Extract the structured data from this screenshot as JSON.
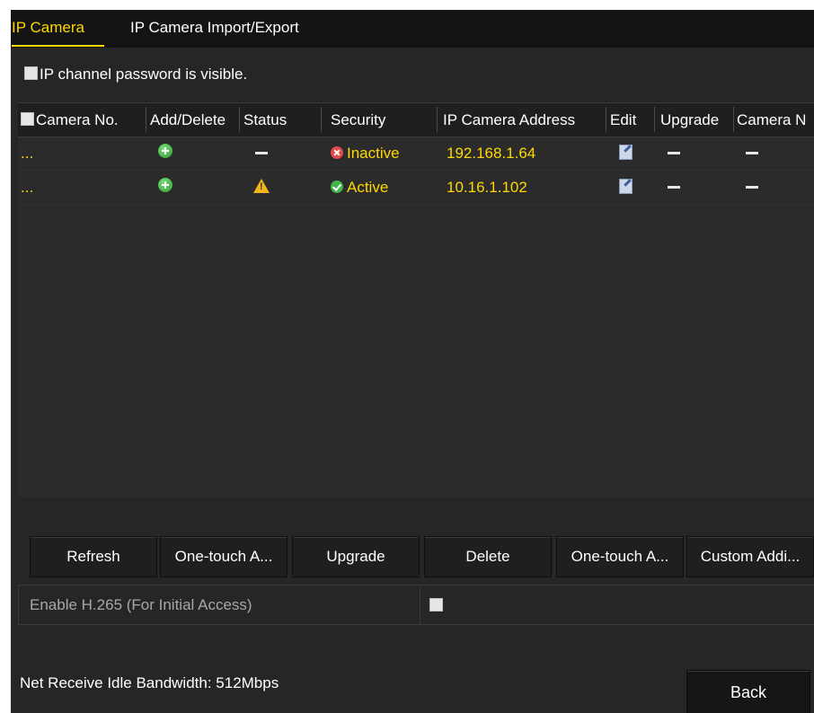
{
  "tabs": [
    {
      "label": "IP Camera",
      "active": true
    },
    {
      "label": "IP Camera Import/Export",
      "active": false
    }
  ],
  "password_visible": {
    "label": "IP channel password is visible.",
    "checked": false
  },
  "table": {
    "columns": [
      "Camera No.",
      "Add/Delete",
      "Status",
      "Security",
      "IP Camera Address",
      "Edit",
      "Upgrade",
      "Camera N"
    ],
    "rows": [
      {
        "camera_no": "...",
        "add_icon": "add-icon",
        "status": "dash",
        "security": "Inactive",
        "security_icon": "error-icon",
        "ip": "192.168.1.64",
        "edit_icon": "edit-icon",
        "upgrade": "dash",
        "camera_name": "dash"
      },
      {
        "camera_no": "...",
        "add_icon": "add-icon",
        "status": "warning",
        "security": "Active",
        "security_icon": "check-icon",
        "ip": "10.16.1.102",
        "edit_icon": "edit-icon",
        "upgrade": "dash",
        "camera_name": "dash"
      }
    ]
  },
  "scrollbar": {
    "left": "‹",
    "right": "›"
  },
  "buttons": {
    "refresh": "Refresh",
    "one_touch_1": "One-touch A...",
    "upgrade": "Upgrade",
    "delete": "Delete",
    "one_touch_2": "One-touch A...",
    "custom_add": "Custom Addi..."
  },
  "h265": {
    "label": "Enable H.265 (For Initial Access)",
    "checked": false
  },
  "bandwidth": "Net Receive Idle Bandwidth: 512Mbps",
  "back": "Back",
  "colors": {
    "accent": "#ffd800",
    "background": "#262626"
  }
}
